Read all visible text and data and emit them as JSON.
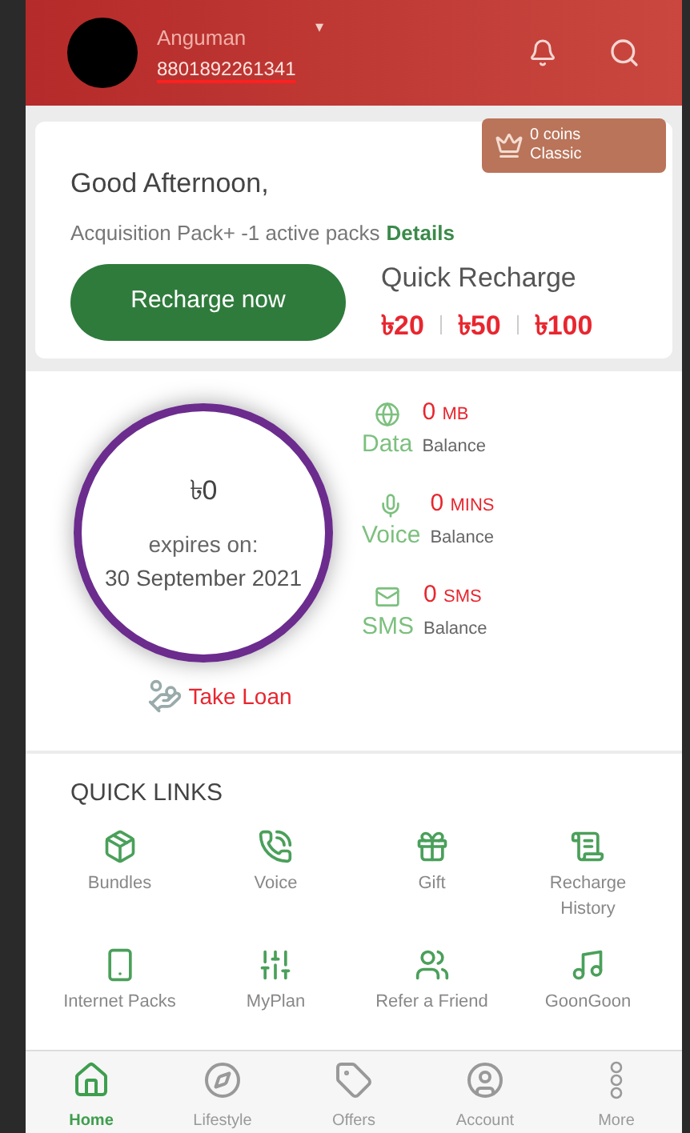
{
  "header": {
    "name": "Anguman",
    "phone": "8801892261341",
    "dropdown": "▾"
  },
  "status_badge": {
    "coins": "0 coins",
    "tier": "Classic"
  },
  "greeting": "Good Afternoon,",
  "packs": {
    "text": "Acquisition Pack+ -1 active packs",
    "link": "Details"
  },
  "recharge_button": "Recharge now",
  "quick_recharge": {
    "title": "Quick Recharge",
    "amounts": [
      "৳20",
      "৳50",
      "৳100"
    ]
  },
  "balance": {
    "amount": "৳0",
    "expires_label": "expires on:",
    "expires_date": "30 September 2021"
  },
  "take_loan": "Take Loan",
  "usage": [
    {
      "kind": "data",
      "label": "Data",
      "value": "0",
      "unit": "MB",
      "sub": "Balance"
    },
    {
      "kind": "voice",
      "label": "Voice",
      "value": "0",
      "unit": "MINS",
      "sub": "Balance"
    },
    {
      "kind": "sms",
      "label": "SMS",
      "value": "0",
      "unit": "SMS",
      "sub": "Balance"
    }
  ],
  "quick_links": {
    "title": "QUICK LINKS",
    "items": [
      {
        "kind": "bundles",
        "label": "Bundles"
      },
      {
        "kind": "voice",
        "label": "Voice"
      },
      {
        "kind": "gift",
        "label": "Gift"
      },
      {
        "kind": "history",
        "label": "Recharge History"
      },
      {
        "kind": "internet",
        "label": "Internet Packs"
      },
      {
        "kind": "plan",
        "label": "MyPlan"
      },
      {
        "kind": "refer",
        "label": "Refer a Friend"
      },
      {
        "kind": "music",
        "label": "GoonGoon"
      }
    ]
  },
  "bottom_nav": [
    {
      "kind": "home",
      "label": "Home",
      "selected": true
    },
    {
      "kind": "lifestyle",
      "label": "Lifestyle",
      "selected": false
    },
    {
      "kind": "offers",
      "label": "Offers",
      "selected": false
    },
    {
      "kind": "account",
      "label": "Account",
      "selected": false
    },
    {
      "kind": "more",
      "label": "More",
      "selected": false
    }
  ]
}
